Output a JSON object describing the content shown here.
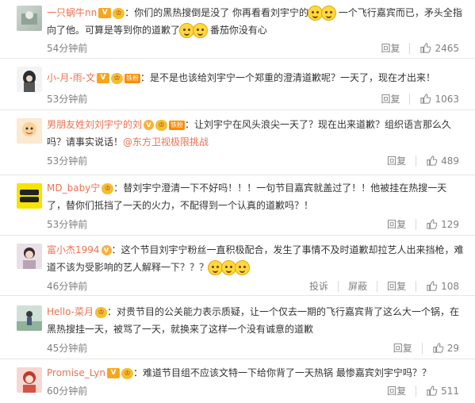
{
  "actions": {
    "reply": "回复",
    "report": "投诉",
    "block": "屏蔽"
  },
  "comments": [
    {
      "user": "一只蜗牛nn",
      "text1": "：你们的黑热搜倒是没了  你再看看刘宇宁的",
      "text2": "  一个飞行嘉宾而已，矛头全指向了他。可算是等到你的道歉了",
      "text3": "  番茄你没有心",
      "time": "54分钟前",
      "likes": "2465"
    },
    {
      "user": "小-月-雨-文",
      "fan_label": "铁粉",
      "text1": "：是不是也该给刘宇宁一个郑重的澄清道歉呢？一天了，现在才出来！",
      "time": "53分钟前",
      "likes": "1063"
    },
    {
      "user": "男朋友姓刘刘宇宁的刘",
      "fan_label": "铁粉",
      "text1": "：让刘宇宁在风头浪尖一天了？现在出来道歉？组织语言那么久吗？请事实说话！",
      "link": "@东方卫视极限挑战",
      "time": "53分钟前",
      "likes": "489"
    },
    {
      "user": "MD_baby宁",
      "text1": "：替刘宇宁澄清一下不好吗！！！一句节目嘉宾就盖过了！！他被挂在热搜一天了，替你们抵挡了一天的火力，不配得到一个认真的道歉吗？！",
      "time": "53分钟前",
      "likes": "129"
    },
    {
      "user": "富小杰1994",
      "text1": "：这个节目刘宇宁粉丝一直积极配合，发生了事情不及时道歉却拉艺人出来挡枪，难道不该为受影响的艺人解释一下？？？",
      "time": "46分钟前",
      "likes": "108"
    },
    {
      "user": "Hello-菜月",
      "text1": "：对贵节目的公关能力表示质疑，让一个仅去一期的飞行嘉宾背了这么大一个锅，在黑热搜挂一天，被骂了一天，就换来了这样一个没有诚意的道歉",
      "time": "45分钟前",
      "likes": "29"
    },
    {
      "user": "Promise_Lyn",
      "text1": "：难道节目组不应该文特一下给你背了一天热锅 最惨嘉宾刘宇宁吗？？",
      "time": "60分钟前",
      "likes": "511"
    }
  ]
}
